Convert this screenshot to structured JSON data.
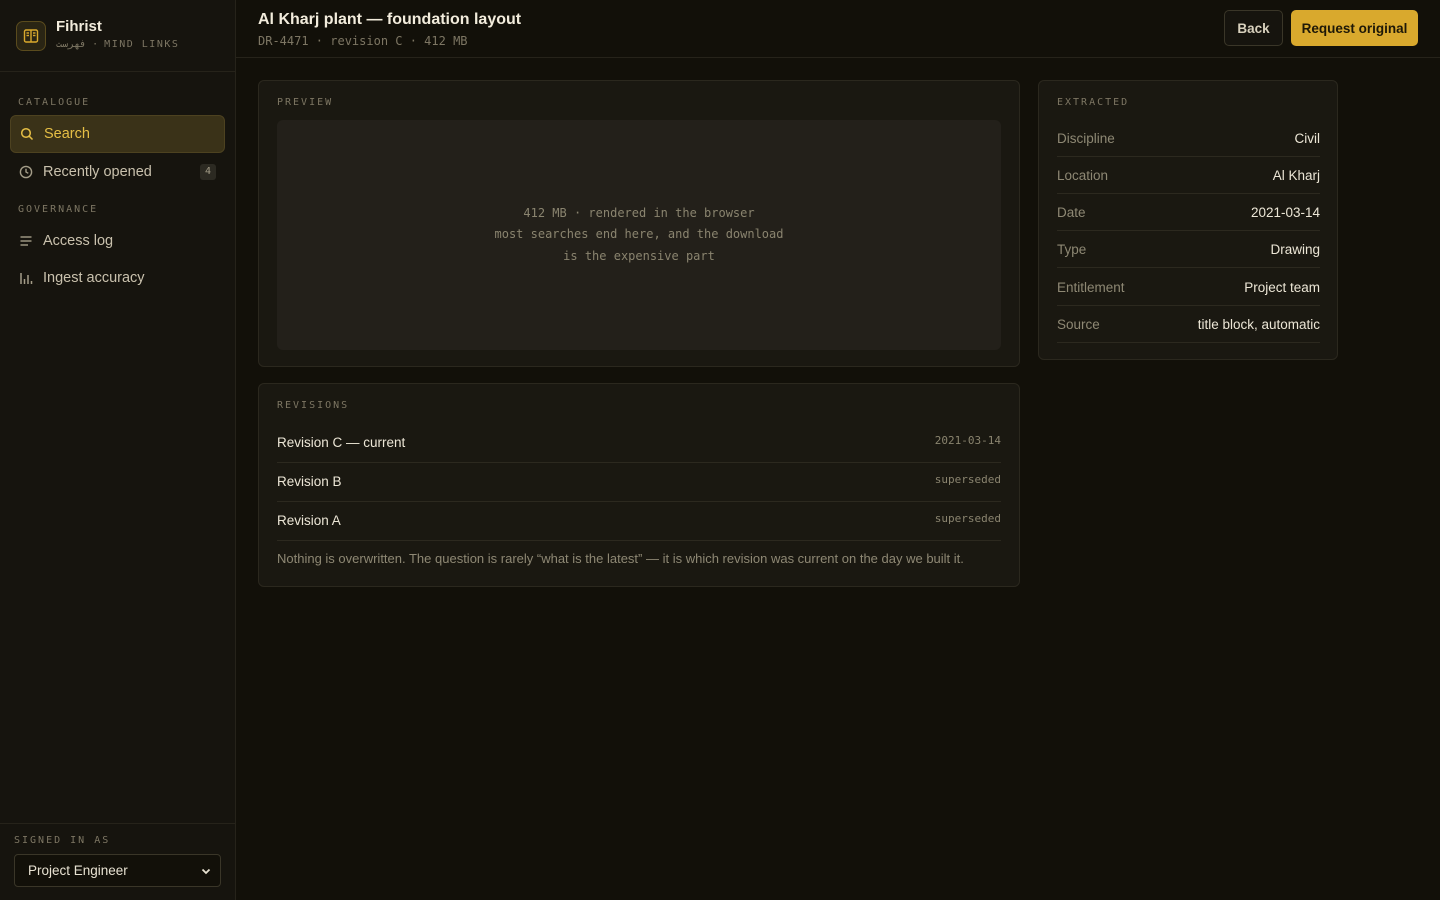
{
  "brand": {
    "name": "Fihrist",
    "subtitle": "فهرست · MIND LINKS"
  },
  "sidebar": {
    "section_catalogue": "CATALOGUE",
    "section_governance": "GOVERNANCE",
    "items": [
      {
        "label": "Search",
        "icon": "search-icon",
        "active": true
      },
      {
        "label": "Recently opened",
        "icon": "clock-icon",
        "badge": "4"
      },
      {
        "label": "Access log",
        "icon": "list-icon"
      },
      {
        "label": "Ingest accuracy",
        "icon": "bar-chart-icon"
      }
    ],
    "signed_in_label": "SIGNED IN AS",
    "role": "Project Engineer"
  },
  "header": {
    "title": "Al Kharj plant — foundation layout",
    "meta": "DR-4471 · revision C · 412 MB",
    "back_label": "Back",
    "request_label": "Request original"
  },
  "preview": {
    "label": "PREVIEW",
    "line1": "412 MB · rendered in the browser",
    "line2": "most searches end here, and the download",
    "line3": "is the expensive part"
  },
  "revisions": {
    "label": "REVISIONS",
    "rows": [
      {
        "name": "Revision C — current",
        "status": "2021-03-14"
      },
      {
        "name": "Revision B",
        "status": "superseded"
      },
      {
        "name": "Revision A",
        "status": "superseded"
      }
    ],
    "note": "Nothing is overwritten. The question is rarely “what is the latest” — it is which revision was current on the day we built it."
  },
  "extracted": {
    "label": "EXTRACTED",
    "fields": [
      {
        "key": "Discipline",
        "value": "Civil"
      },
      {
        "key": "Location",
        "value": "Al Kharj"
      },
      {
        "key": "Date",
        "value": "2021-03-14"
      },
      {
        "key": "Type",
        "value": "Drawing"
      },
      {
        "key": "Entitlement",
        "value": "Project team"
      },
      {
        "key": "Source",
        "value": "title block, automatic"
      }
    ]
  },
  "colors": {
    "accent": "#d9a92d",
    "background": "#121009",
    "panel": "#1a1811"
  }
}
